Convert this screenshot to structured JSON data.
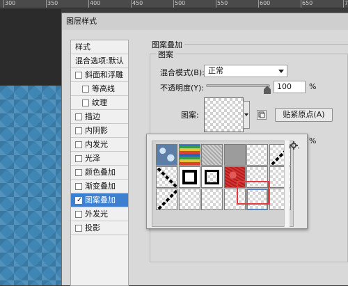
{
  "ruler": {
    "labels": [
      "300",
      "350",
      "400",
      "450",
      "500",
      "550",
      "600",
      "650",
      "700"
    ]
  },
  "dialog": {
    "title": "图层样式"
  },
  "style_list": {
    "items": [
      {
        "label": "样式",
        "type": "header"
      },
      {
        "label": "混合选项:默认",
        "type": "header"
      },
      {
        "label": "斜面和浮雕",
        "checked": false,
        "indent": false
      },
      {
        "label": "等高线",
        "checked": false,
        "indent": true
      },
      {
        "label": "纹理",
        "checked": false,
        "indent": true
      },
      {
        "label": "描边",
        "checked": false,
        "indent": false
      },
      {
        "label": "内阴影",
        "checked": false,
        "indent": false
      },
      {
        "label": "内发光",
        "checked": false,
        "indent": false
      },
      {
        "label": "光泽",
        "checked": false,
        "indent": false
      },
      {
        "label": "颜色叠加",
        "checked": false,
        "indent": false
      },
      {
        "label": "渐变叠加",
        "checked": false,
        "indent": false
      },
      {
        "label": "图案叠加",
        "checked": true,
        "indent": false,
        "selected": true
      },
      {
        "label": "外发光",
        "checked": false,
        "indent": false
      },
      {
        "label": "投影",
        "checked": false,
        "indent": false
      }
    ]
  },
  "panel": {
    "section_title": "图案叠加",
    "group_title": "图案",
    "blend_mode_label": "混合模式(B):",
    "blend_mode_value": "正常",
    "opacity_label": "不透明度(Y):",
    "opacity_value": "100",
    "opacity_unit": "%",
    "opacity_level": 1.0,
    "pattern_label": "图案:",
    "snap_button_label": "贴紧原点(A)",
    "scale_unit": "%"
  },
  "picker": {
    "swatches": [
      {
        "kind": "blue-bubbles"
      },
      {
        "kind": "rainbow"
      },
      {
        "kind": "gray-noise"
      },
      {
        "kind": "gray-light"
      },
      {
        "kind": "checker"
      },
      {
        "kind": "diagonal-black"
      },
      {
        "kind": "diagonal-black-rev"
      },
      {
        "kind": "black-square"
      },
      {
        "kind": "checker-square"
      },
      {
        "kind": "red-texture"
      },
      {
        "kind": "checker-dots"
      },
      {
        "kind": "checker-corner"
      },
      {
        "kind": "diagonal-black-2"
      },
      {
        "kind": "checker-pale"
      },
      {
        "kind": "checker-pale-2"
      },
      {
        "kind": "checker-plain"
      },
      {
        "kind": "checker-selected"
      },
      {
        "kind": "checker-faint"
      }
    ],
    "settings_icon": "gear-icon",
    "highlight_color": "#e23b3b"
  },
  "colors": {
    "selected_item": "#3d80cf",
    "canvas_blue": "#3f86b4"
  }
}
